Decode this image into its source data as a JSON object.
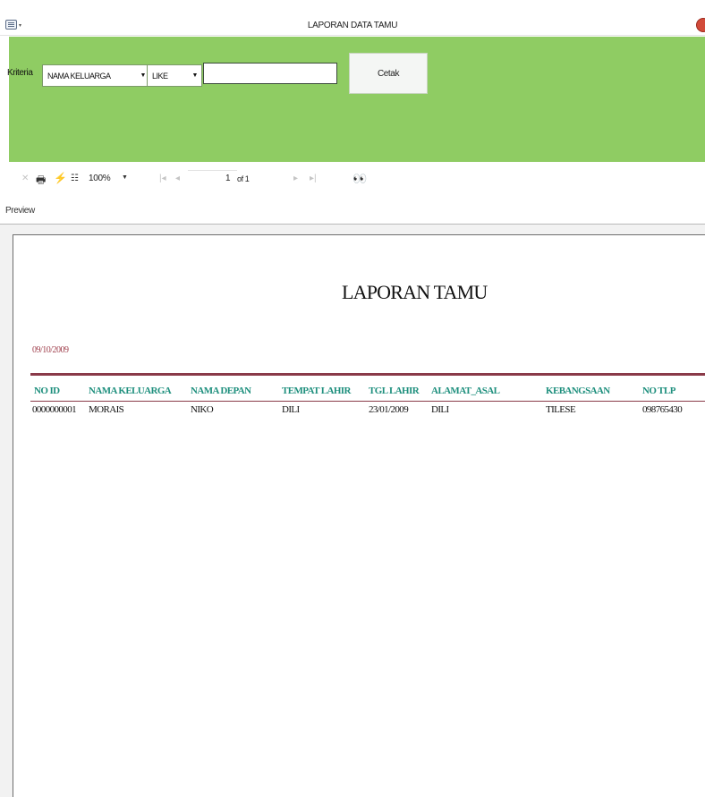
{
  "window": {
    "title": "LAPORAN DATA TAMU",
    "icon": "app-window-icon",
    "close_icon": "close-icon"
  },
  "criteria": {
    "label": "Kriteria",
    "field_select": "NAMA KELUARGA",
    "operator_select": "LIKE",
    "search_value": "",
    "print_button": "Cetak",
    "panel_color": "#8fcc63"
  },
  "toolbar": {
    "zoom": "100%",
    "page_current": "1",
    "page_of": "of 1",
    "icons": [
      "close-icon",
      "print-icon",
      "refresh-icon",
      "group-tree-icon",
      "zoom-dropdown",
      "first-page-icon",
      "previous-page-icon",
      "next-page-icon",
      "last-page-icon",
      "find-icon"
    ]
  },
  "preview": {
    "label": "Preview"
  },
  "report": {
    "title": "LAPORAN TAMU",
    "date": "09/10/2009",
    "columns": [
      "NO ID",
      "NAMA KELUARGA",
      "NAMA DEPAN",
      "TEMPAT LAHIR",
      "TGL LAHIR",
      "ALAMAT_ASAL",
      "KEBANGSAAN",
      "NO TLP"
    ],
    "rows": [
      [
        "0000000001",
        "MORAIS",
        "NIKO",
        "DILI",
        "23/01/2009",
        "DILI",
        "TILESE",
        "098765430"
      ]
    ],
    "header_color": "#1e8f7d",
    "rule_color": "#8a3a49",
    "date_color": "#a0404d"
  }
}
